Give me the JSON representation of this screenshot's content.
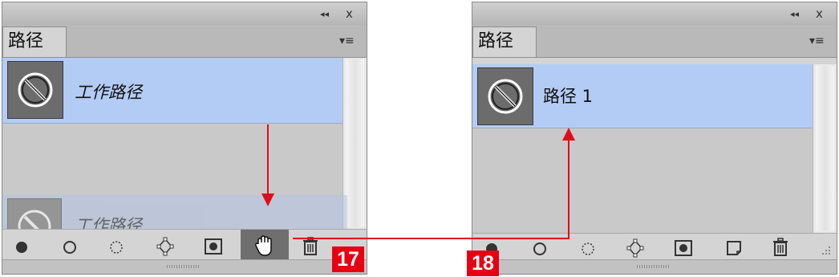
{
  "colors": {
    "panel_bg": "#d4d4d4",
    "selected_row": "#b3ccf5",
    "annotation_red": "#e60012"
  },
  "left_panel": {
    "titlebar": {
      "collapse_icon": "double-chevron-left-icon",
      "collapse_glyph": "◂◂",
      "close_glyph": "x"
    },
    "tab_label": "路径",
    "menu_glyph": "▾≡",
    "path_row_label": "工作路径",
    "ghost_row_label": "工作路径",
    "toolbar_icons": [
      "fill-path-icon",
      "stroke-path-icon",
      "load-selection-icon",
      "make-work-path-icon",
      "add-mask-icon",
      "hand-cursor-icon",
      "trash-icon"
    ]
  },
  "right_panel": {
    "titlebar": {
      "collapse_icon": "double-chevron-left-icon",
      "collapse_glyph": "◂◂",
      "close_glyph": "x"
    },
    "tab_label": "路径",
    "menu_glyph": "▾≡",
    "path_row_label": "路径 1",
    "toolbar_icons": [
      "fill-path-icon",
      "stroke-path-icon",
      "load-selection-icon",
      "make-work-path-icon",
      "add-mask-icon",
      "new-path-icon",
      "trash-icon"
    ]
  },
  "annotations": {
    "step_left": "17",
    "step_right": "18"
  }
}
